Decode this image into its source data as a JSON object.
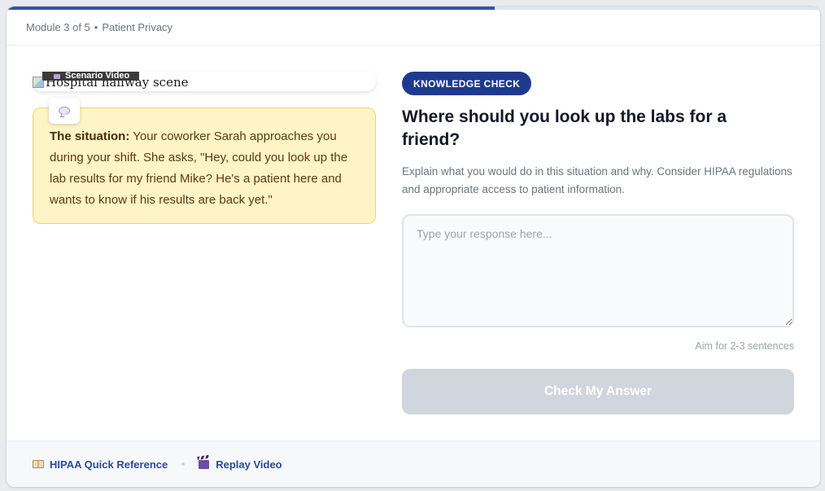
{
  "progress": {
    "fraction": 0.6
  },
  "header": {
    "module": "Module 3 of 5",
    "separator": "•",
    "topic": "Patient Privacy"
  },
  "video": {
    "badge": "Scenario Video",
    "alt_text": "Hospital hallway scene"
  },
  "situation": {
    "label": "The situation:",
    "text": "Your coworker Sarah approaches you during your shift. She asks, \"Hey, could you look up the lab results for my friend Mike? He's a patient here and wants to know if his results are back yet.\""
  },
  "knowledge_check": {
    "tag": "KNOWLEDGE CHECK",
    "question": "Where should you look up the labs for a friend?",
    "instructions": "Explain what you would do in this situation and why. Consider HIPAA regulations and appropriate access to patient information.",
    "response_placeholder": "Type your response here...",
    "response_value": "",
    "hint": "Aim for 2-3 sentences",
    "submit_label": "Check My Answer"
  },
  "footer": {
    "reference_label": "HIPAA Quick Reference",
    "replay_label": "Replay Video"
  },
  "colors": {
    "accent": "#1e3a8f",
    "progress": "#2f56ad",
    "situation_bg": "#fef4c6",
    "situation_border": "#f0d66a",
    "button_disabled": "#d1d5dd",
    "link": "#2b4a93"
  },
  "icons": {
    "situation": "speech-bubble-icon",
    "reference": "book-icon",
    "replay": "clapper-board-icon",
    "video_badge": "video-camera-icon"
  }
}
